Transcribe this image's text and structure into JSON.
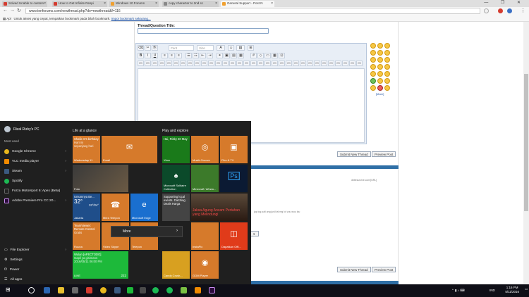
{
  "browser": {
    "tabs": [
      {
        "label": "Solved Unable to custom",
        "color": "#d43b2f"
      },
      {
        "label": "How to Get Infinite Respi",
        "color": "#d43b2f"
      },
      {
        "label": "Windows 10 Forums",
        "color": "#f0a030"
      },
      {
        "label": "copy character to 2nd sc",
        "color": "#888888"
      },
      {
        "label": "General Support - Post N",
        "color": "#f0a030"
      }
    ],
    "window_controls": "— ❐ ✕",
    "url": "www.tenforums.com/newthread.php?do=newthread&f=116",
    "bookmarks_apps": "Apl",
    "bookmarks_hint": "Untuk akses yang cepat, tempatkan bookmark pada bilah bookmark.",
    "bookmarks_import": "Impor bookmark sekarang..."
  },
  "page": {
    "thread_title_label": "Thread/Question Title:",
    "font_select": "Font",
    "size_select": "Size",
    "smilies_more": "[More]",
    "submit_label": "Submit New Thread",
    "preview_label": "Preview Post",
    "faint_url": "dbitesurvive.com/[URL]",
    "faint_line": "jap log pali ang jusil tal reg lol vuu wuu lou"
  },
  "start_menu": {
    "user_name": "Rizal Rizky's PC",
    "most_used_label": "Most used",
    "apps": [
      {
        "name": "Google Chrome",
        "color": "#e8b71d"
      },
      {
        "name": "VLC media player",
        "color": "#f08a00"
      },
      {
        "name": "Steam",
        "color": "#3b5a80"
      },
      {
        "name": "Spotify",
        "color": "#1db954"
      },
      {
        "name": "Forza Motorsport 6: Apex (Beta)",
        "color": "#222222"
      },
      {
        "name": "Adobe Premiere Pro CC 20...",
        "color": "#2a0a3a"
      }
    ],
    "bottom": [
      {
        "name": "File Explorer",
        "icon": "▭"
      },
      {
        "name": "Settings",
        "icon": "⚙"
      },
      {
        "name": "Power",
        "icon": "⏻"
      },
      {
        "name": "All apps",
        "icon": "☰"
      }
    ],
    "group_life": "Life at a glance",
    "group_play": "Play and explore",
    "tiles": {
      "calendar_event": "Shafie S's birthday",
      "calendar_sub": "Hari ini",
      "calendar_sub2": "sepanjang hari",
      "calendar_day": "Wednesday 11",
      "mail": "Email",
      "photos": "Foto",
      "weather_city": "Umumnya Be...",
      "weather_temp": "32°",
      "weather_range": "33°/24°",
      "weather_loc": "Jakarta",
      "people": "Mitra Telepon",
      "edge": "Microsoft Edge",
      "teamviewer": "TeamViewer: Remote Control",
      "teamviewer_sub": "Gratis",
      "teamviewer_lbl": "Ruuna",
      "skype": "Video Skype",
      "phone": "Telepon",
      "line_title": "Wulan [AFECTODO]",
      "line_sub": "Gapil ya gisimann",
      "line_date": "2016/05/11 06:00 PM",
      "line_app": "LINE",
      "line_count": "222",
      "xbox_greet": "Hai, Rizky 20 May",
      "xbox": "Xbox",
      "groove": "Musik Groove",
      "films": "Film & TV",
      "solitaire": "Microsoft Solitaire Collection",
      "minecraft": "Minecraft: Windo...",
      "photoshop": "Ps",
      "news1": "Supporting local events. Dazzling Deals Harga",
      "news2": "Jaksa Agung Ancam Pertahan yang Melindungi",
      "instapic": "InstaPic",
      "office": "Dapatkan Offi...",
      "candy": "Candy Crush...",
      "gom": "GOM Player",
      "more": "More"
    }
  },
  "taskbar": {
    "time": "1:16 PM",
    "date": "5/11/2016",
    "lang": "IND"
  }
}
